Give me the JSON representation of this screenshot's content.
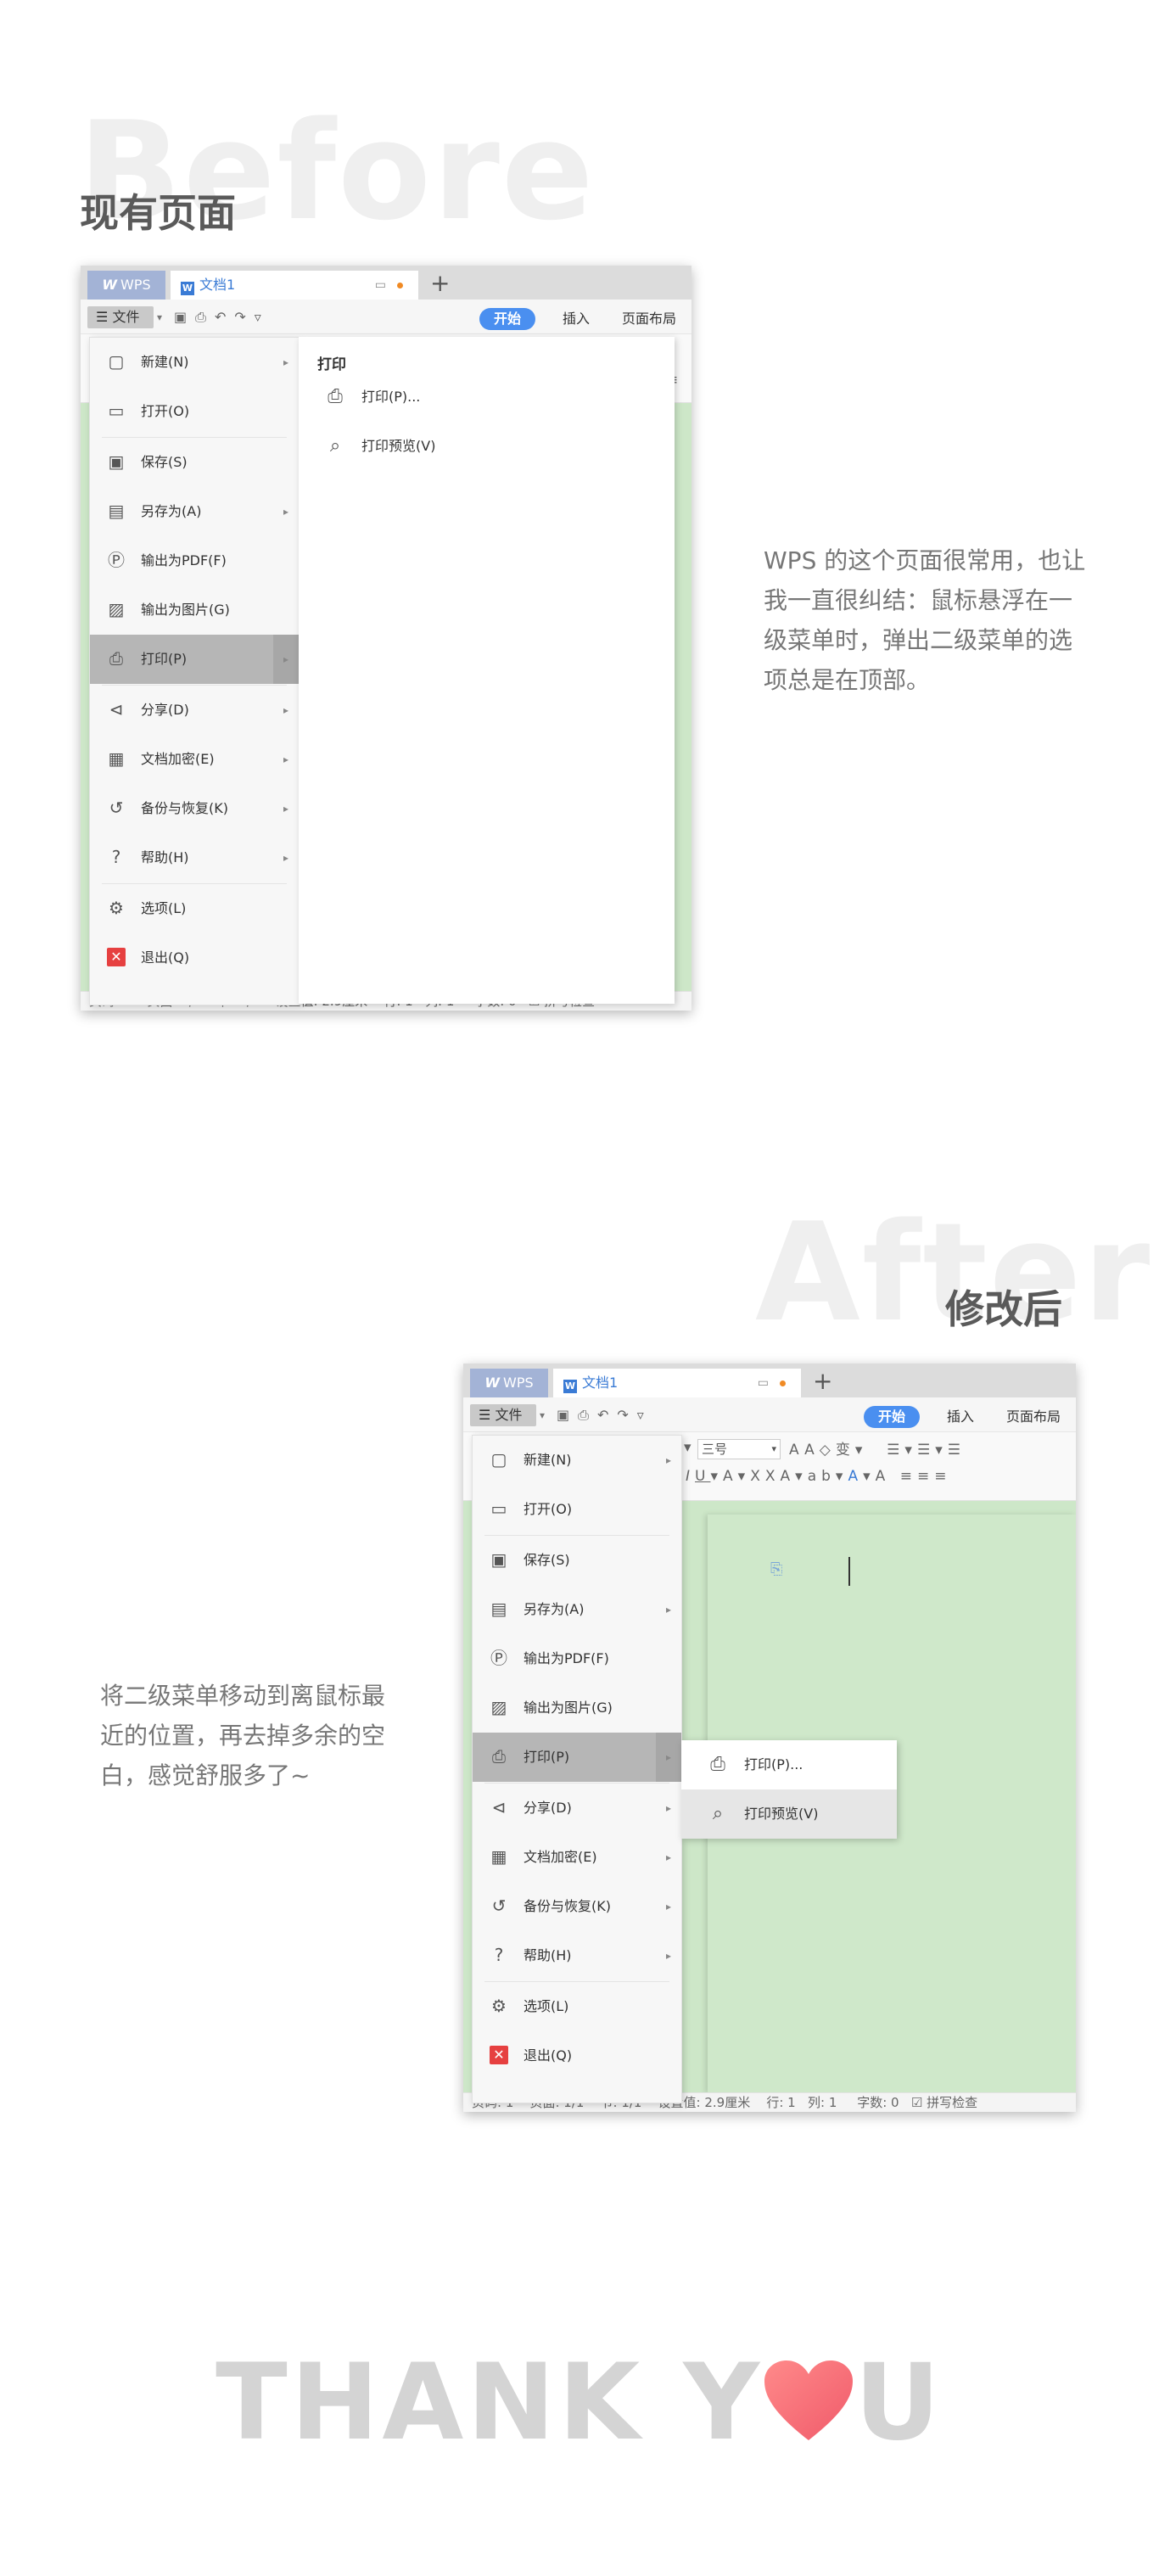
{
  "before": {
    "bg_word": "Before",
    "title": "现有页面",
    "description": "WPS 的这个页面很常用，也让我一直很纠结：鼠标悬浮在一级菜单时，弹出二级菜单的选项总是在顶部。"
  },
  "after": {
    "bg_word": "After",
    "title": "修改后",
    "description": "将二级菜单移动到离鼠标最近的位置，再去掉多余的空白，感觉舒服多了~"
  },
  "app": {
    "wps_tab": "WPS",
    "doc_tab": "文档1",
    "new_tab": "+",
    "file_button": "文件",
    "ribbon_tabs": [
      "开始",
      "插入",
      "页面布局"
    ],
    "font_size": "三号",
    "status": {
      "page": "页码: 1",
      "pages": "页面: 1/1",
      "section": "节: 1/1",
      "setting": "设置值: 2.9厘米",
      "row": "行: 1",
      "col": "列: 1",
      "words": "字数: 0",
      "spell": "拼写检查"
    }
  },
  "menu": {
    "items": [
      {
        "label": "新建(N)",
        "icon": "new-doc-icon",
        "glyph": "▢",
        "arrow": true
      },
      {
        "label": "打开(O)",
        "icon": "folder-icon",
        "glyph": "▭",
        "arrow": false
      },
      {
        "label": "保存(S)",
        "icon": "save-icon",
        "glyph": "▣",
        "arrow": false
      },
      {
        "label": "另存为(A)",
        "icon": "save-as-icon",
        "glyph": "▤",
        "arrow": true
      },
      {
        "label": "输出为PDF(F)",
        "icon": "pdf-icon",
        "glyph": "Ⓟ",
        "arrow": false
      },
      {
        "label": "输出为图片(G)",
        "icon": "image-icon",
        "glyph": "▨",
        "arrow": false
      },
      {
        "label": "打印(P)",
        "icon": "printer-icon",
        "glyph": "⎙",
        "arrow": true,
        "active": true
      },
      {
        "label": "分享(D)",
        "icon": "share-icon",
        "glyph": "⊲",
        "arrow": true
      },
      {
        "label": "文档加密(E)",
        "icon": "encrypt-icon",
        "glyph": "▦",
        "arrow": true
      },
      {
        "label": "备份与恢复(K)",
        "icon": "backup-icon",
        "glyph": "↺",
        "arrow": true
      },
      {
        "label": "帮助(H)",
        "icon": "help-icon",
        "glyph": "?",
        "arrow": true
      },
      {
        "label": "选项(L)",
        "icon": "gear-icon",
        "glyph": "⚙",
        "arrow": false
      },
      {
        "label": "退出(Q)",
        "icon": "exit-icon",
        "glyph": "✕",
        "arrow": false
      }
    ],
    "arrow_glyph": "▸"
  },
  "submenu": {
    "header": "打印",
    "items": [
      {
        "label": "打印(P)...",
        "icon": "printer-icon",
        "glyph": "⎙"
      },
      {
        "label": "打印预览(V)",
        "icon": "print-preview-icon",
        "glyph": "⌕"
      }
    ]
  },
  "thank_you": {
    "text_left": "THANK Y",
    "text_right": "U",
    "heart_color": "#f57373"
  },
  "colors": {
    "accent": "#4a8ff0",
    "doc_bg": "#cde7c8",
    "menu_active": "#b6b6b6",
    "exit_red": "#e64040"
  }
}
